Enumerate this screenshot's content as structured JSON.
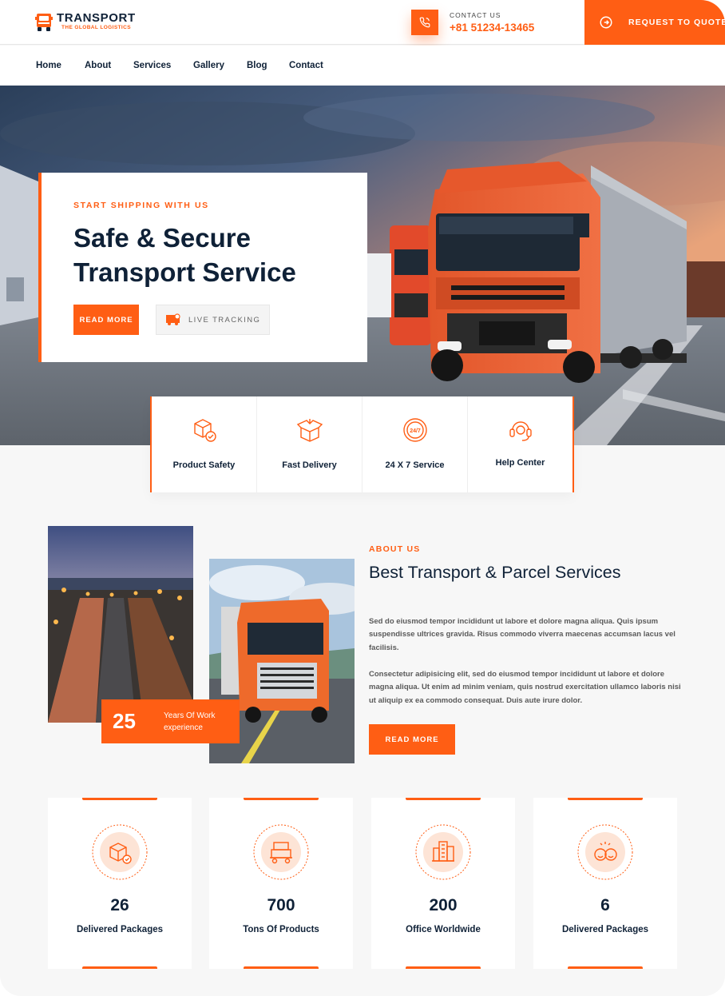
{
  "brand": {
    "name": "TRANSPORT",
    "tagline": "THE GLOBAL LOGISTICS",
    "accent": "#ff5e14",
    "dark": "#0f2137"
  },
  "header": {
    "contact_label": "CONTACT US",
    "contact_number": "+81 51234-13465",
    "quote_button": "REQUEST TO QUOTE",
    "phone_icon": "phone-icon",
    "quote_icon": "arrow-circle-right-icon"
  },
  "nav": {
    "items": [
      "Home",
      "About",
      "Services",
      "Gallery",
      "Blog",
      "Contact"
    ]
  },
  "hero": {
    "eyebrow": "START SHIPPING WITH US",
    "title": "Safe & Secure Transport Service",
    "read_more": "READ MORE",
    "live_tracking": "LIVE TRACKING",
    "tracking_icon": "truck-tracking-icon"
  },
  "features": [
    {
      "label": "Product Safety",
      "icon": "package-shield-icon"
    },
    {
      "label": "Fast Delivery",
      "icon": "open-box-icon"
    },
    {
      "label": "24 X 7 Service",
      "icon": "clock-24-7-icon"
    },
    {
      "label": "Help Center",
      "icon": "headset-icon"
    }
  ],
  "about": {
    "eyebrow": "ABOUT US",
    "title": "Best Transport & Parcel Services",
    "paragraph1": "Sed do eiusmod tempor incididunt ut labore et dolore magna aliqua. Quis ipsum suspendisse ultrices gravida. Risus commodo viverra maecenas accumsan lacus vel facilisis.",
    "paragraph2": "Consectetur adipisicing elit, sed do eiusmod tempor incididunt ut labore et dolore magna aliqua. Ut enim ad minim veniam, quis nostrud exercitation ullamco laboris nisi ut aliquip ex ea commodo consequat. Duis aute irure dolor.",
    "read_more": "READ MORE",
    "experience_number": "25",
    "experience_text": "Years Of Work experience"
  },
  "stats": [
    {
      "value": "26",
      "label": "Delivered Packages",
      "icon": "package-check-icon"
    },
    {
      "value": "700",
      "label": "Tons Of Products",
      "icon": "cargo-cart-icon"
    },
    {
      "value": "200",
      "label": "Office Worldwide",
      "icon": "office-building-icon"
    },
    {
      "value": "6",
      "label": "Delivered Packages",
      "icon": "happy-faces-icon"
    }
  ]
}
